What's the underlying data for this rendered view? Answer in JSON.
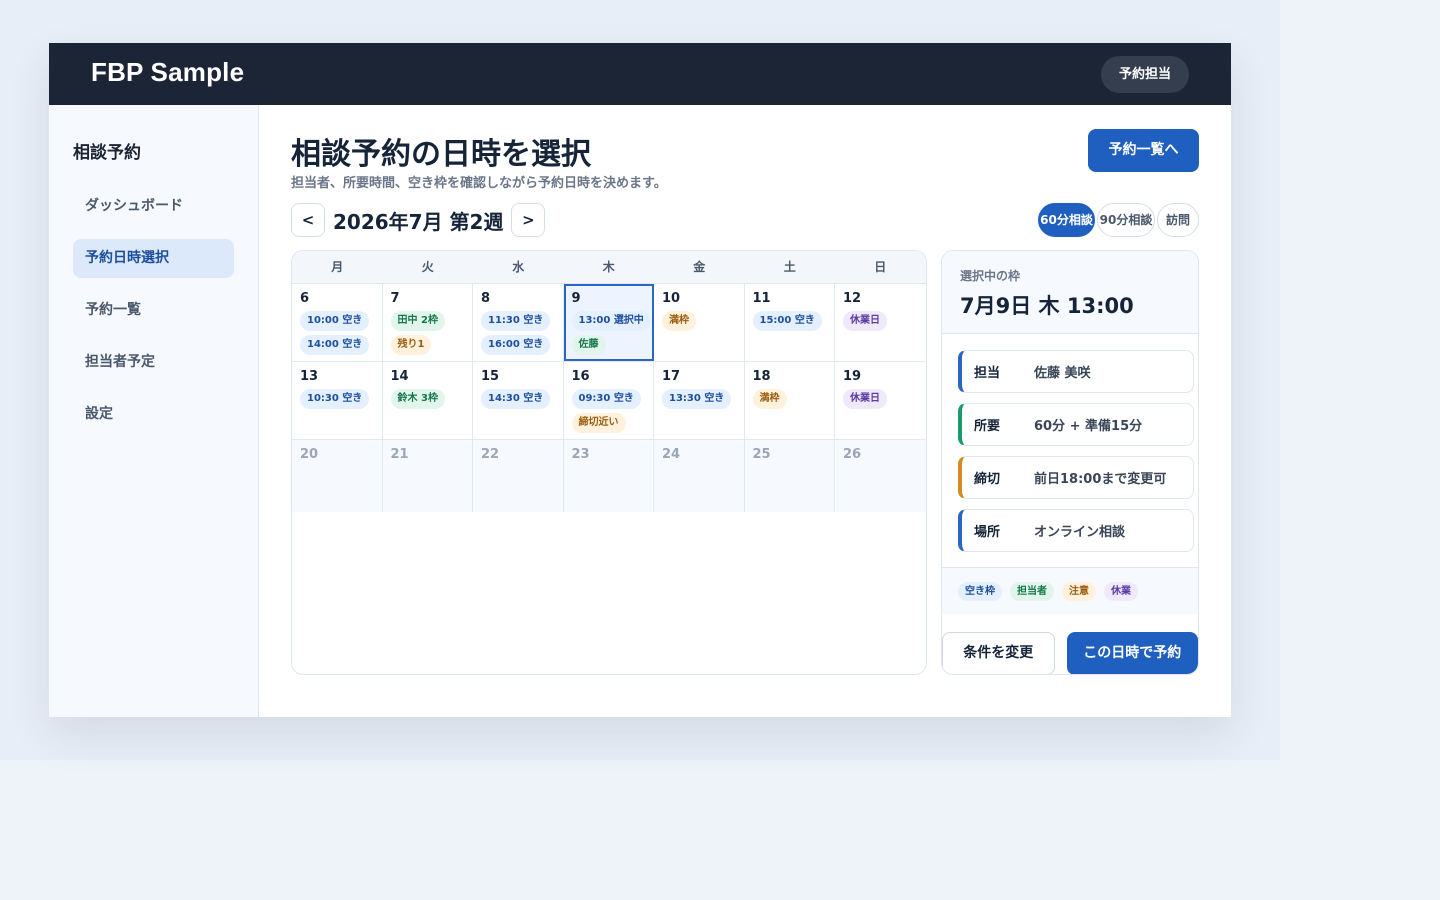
{
  "app": {
    "brand": "FBP Sample",
    "role": "予約担当"
  },
  "sidebar": {
    "title": "相談予約",
    "items": [
      {
        "label": "ダッシュボード"
      },
      {
        "label": "予約日時選択"
      },
      {
        "label": "予約一覧"
      },
      {
        "label": "担当者予定"
      },
      {
        "label": "設定"
      }
    ]
  },
  "main": {
    "title": "相談予約の日時を選択",
    "subtitle": "担当者、所要時間、空き枠を確認しながら予約日時を決めます。",
    "list_button": "予約一覧へ",
    "week_label": "2026年7月 第2週",
    "prev": "<",
    "next": ">",
    "durations": [
      "60分相談",
      "90分相談",
      "訪問"
    ],
    "weekdays": [
      "月",
      "火",
      "水",
      "木",
      "金",
      "土",
      "日"
    ],
    "weeks": [
      [
        {
          "day": "6",
          "tags": [
            {
              "text": "10:00 空き",
              "color": "blue"
            },
            {
              "text": "14:00 空き",
              "color": "blue"
            }
          ]
        },
        {
          "day": "7",
          "tags": [
            {
              "text": "田中 2枠",
              "color": "green"
            },
            {
              "text": "残り1",
              "color": "amber"
            }
          ]
        },
        {
          "day": "8",
          "tags": [
            {
              "text": "11:30 空き",
              "color": "blue"
            },
            {
              "text": "16:00 空き",
              "color": "blue"
            }
          ]
        },
        {
          "day": "9",
          "tags": [
            {
              "text": "13:00 選択中",
              "color": "blue"
            },
            {
              "text": "佐藤",
              "color": "green"
            }
          ]
        },
        {
          "day": "10",
          "tags": [
            {
              "text": "満枠",
              "color": "amber"
            }
          ]
        },
        {
          "day": "11",
          "tags": [
            {
              "text": "15:00 空き",
              "color": "blue"
            }
          ]
        },
        {
          "day": "12",
          "tags": [
            {
              "text": "休業日",
              "color": "purple"
            }
          ]
        }
      ],
      [
        {
          "day": "13",
          "tags": [
            {
              "text": "10:30 空き",
              "color": "blue"
            }
          ]
        },
        {
          "day": "14",
          "tags": [
            {
              "text": "鈴木 3枠",
              "color": "green"
            }
          ]
        },
        {
          "day": "15",
          "tags": [
            {
              "text": "14:30 空き",
              "color": "blue"
            }
          ]
        },
        {
          "day": "16",
          "tags": [
            {
              "text": "09:30 空き",
              "color": "blue"
            },
            {
              "text": "締切近い",
              "color": "amber"
            }
          ]
        },
        {
          "day": "17",
          "tags": [
            {
              "text": "13:30 空き",
              "color": "blue"
            }
          ]
        },
        {
          "day": "18",
          "tags": [
            {
              "text": "満枠",
              "color": "amber"
            }
          ]
        },
        {
          "day": "19",
          "tags": [
            {
              "text": "休業日",
              "color": "purple"
            }
          ]
        }
      ],
      [
        {
          "day": "20",
          "tags": []
        },
        {
          "day": "21",
          "tags": []
        },
        {
          "day": "22",
          "tags": []
        },
        {
          "day": "23",
          "tags": []
        },
        {
          "day": "24",
          "tags": []
        },
        {
          "day": "25",
          "tags": []
        },
        {
          "day": "26",
          "tags": []
        }
      ]
    ]
  },
  "panel": {
    "label": "選択中の枠",
    "date": "7月9日 木 13:00",
    "rows": [
      {
        "key": "担当",
        "value": "佐藤 美咲"
      },
      {
        "key": "所要",
        "value": "60分 + 準備15分"
      },
      {
        "key": "締切",
        "value": "前日18:00まで変更可"
      },
      {
        "key": "場所",
        "value": "オンライン相談"
      }
    ],
    "legend": [
      "空き枠",
      "担当者",
      "注意",
      "休業"
    ],
    "change_button": "条件を変更",
    "reserve_button": "この日時で予約"
  },
  "colors": {
    "accent": "#1f5fc0",
    "header": "#1c2536",
    "selected_outline": "#2b66c4"
  }
}
